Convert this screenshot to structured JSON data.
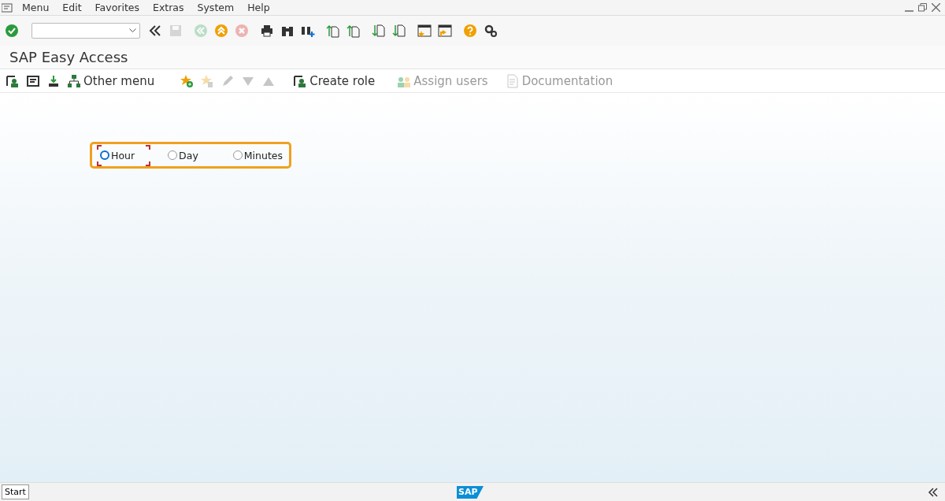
{
  "menu_bar": {
    "items": [
      {
        "label": "Menu"
      },
      {
        "label": "Edit"
      },
      {
        "label": "Favorites"
      },
      {
        "label": "Extras"
      },
      {
        "label": "System"
      },
      {
        "label": "Help"
      }
    ]
  },
  "system_toolbar": {
    "buttons": [
      {
        "disabled": false
      },
      {
        "disabled": false
      },
      {
        "disabled": false
      },
      {
        "disabled": true
      },
      {
        "disabled": true
      },
      {
        "disabled": false
      },
      {
        "disabled": true
      },
      {
        "disabled": false
      },
      {
        "disabled": false
      },
      {
        "disabled": false
      },
      {
        "disabled": false
      },
      {
        "disabled": false
      },
      {
        "disabled": false
      },
      {
        "disabled": false
      },
      {
        "disabled": false
      },
      {
        "disabled": false
      },
      {
        "disabled": false
      },
      {
        "disabled": false
      }
    ]
  },
  "title": "SAP Easy Access",
  "app_toolbar": {
    "buttons": [
      {
        "disabled": false
      },
      {
        "disabled": false
      },
      {
        "disabled": false
      },
      {
        "label": "Other menu",
        "disabled": false
      },
      {
        "disabled": false
      },
      {
        "disabled": true
      },
      {
        "disabled": true
      },
      {
        "disabled": true
      },
      {
        "disabled": true
      },
      {
        "label": "Create role",
        "disabled": false
      },
      {
        "label": "Assign users",
        "disabled": true
      },
      {
        "label": "Documentation",
        "disabled": true
      }
    ]
  },
  "radio_group": {
    "highlighted": true,
    "options": [
      {
        "label": "Hour",
        "selected": false,
        "focused": true
      },
      {
        "label": "Day",
        "selected": false,
        "focused": false
      },
      {
        "label": "Minutes",
        "selected": false,
        "focused": false
      }
    ]
  },
  "status_bar": {
    "start": "Start",
    "logo": "SAP"
  }
}
